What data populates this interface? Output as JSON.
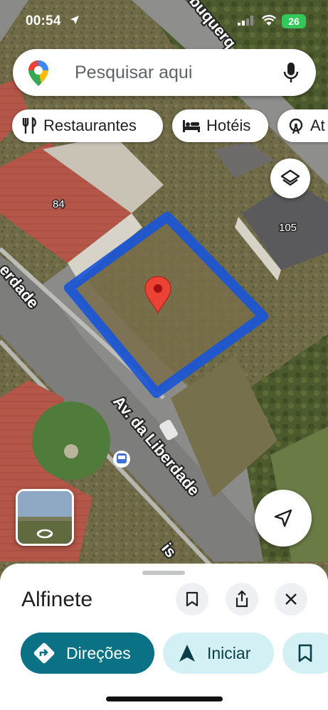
{
  "status": {
    "time": "00:54",
    "battery": "26"
  },
  "search": {
    "placeholder": "Pesquisar aqui"
  },
  "chips": [
    {
      "label": "Restaurantes",
      "icon": "fork-knife-icon"
    },
    {
      "label": "Hotéis",
      "icon": "bed-icon"
    },
    {
      "label": "At",
      "icon": "ferris-wheel-icon"
    }
  ],
  "map": {
    "house_numbers": [
      "84",
      "105"
    ],
    "street_label_main": "Av. da Liberdade",
    "street_label_left": "erdade",
    "street_label_top": "buquerq",
    "street_label_bottom": "is"
  },
  "sheet": {
    "title": "Alfinete",
    "directions_label": "Direções",
    "start_label": "Iniciar"
  },
  "colors": {
    "accent": "#0b7285",
    "pin": "#ea4335",
    "highlight": "#1a56d6"
  }
}
